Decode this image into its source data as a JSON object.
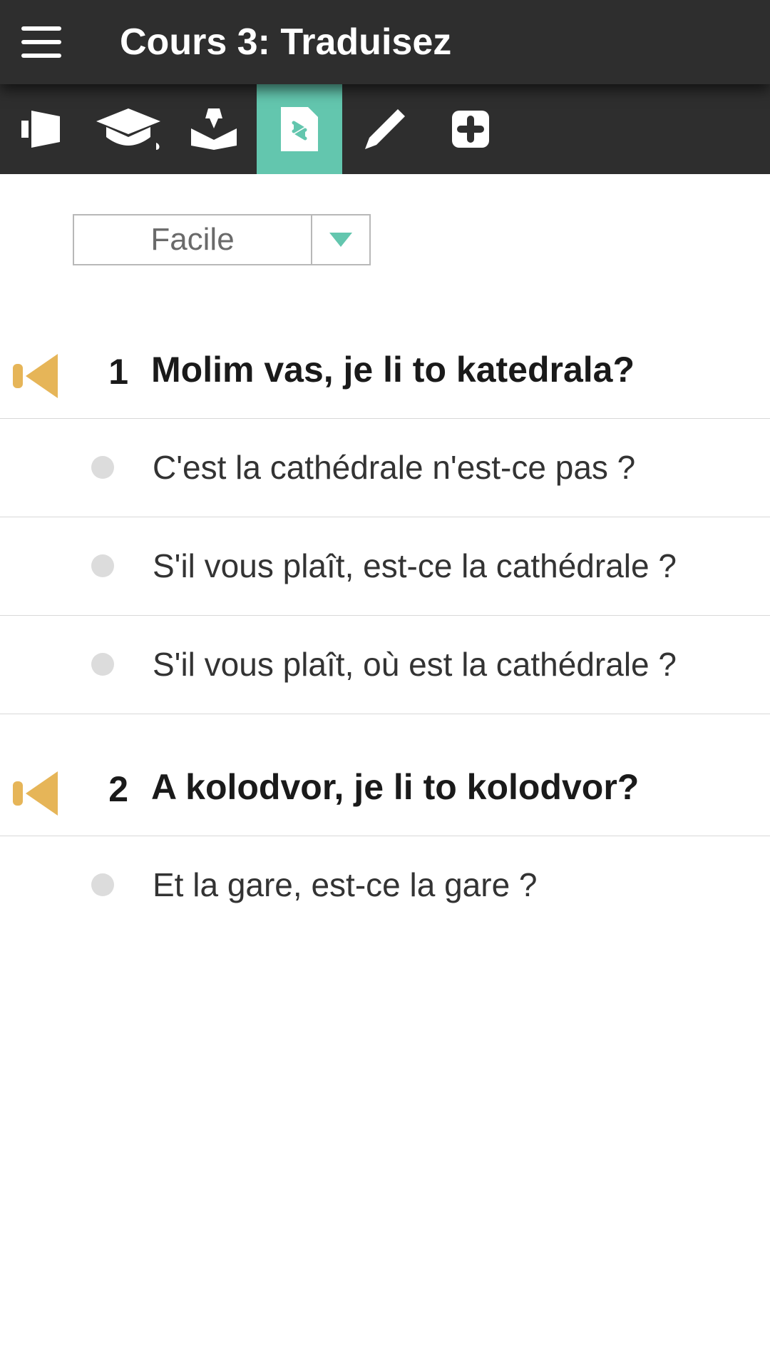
{
  "header": {
    "title": "Cours 3: Traduisez"
  },
  "toolbar": {
    "items": [
      {
        "name": "announce-icon",
        "active": false
      },
      {
        "name": "graduation-cap-icon",
        "active": false
      },
      {
        "name": "inbox-icon",
        "active": false
      },
      {
        "name": "translate-page-icon",
        "active": true
      },
      {
        "name": "pencil-icon",
        "active": false
      },
      {
        "name": "plus-icon",
        "active": false
      }
    ]
  },
  "difficulty": {
    "selected": "Facile"
  },
  "questions": [
    {
      "number": "1",
      "prompt": "Molim vas, je li to katedrala?",
      "options": [
        "C'est la cathédrale n'est-ce pas ?",
        "S'il vous plaît, est-ce la cathédrale ?",
        "S'il vous plaît, où est la cathédrale ?"
      ]
    },
    {
      "number": "2",
      "prompt": "A kolodvor, je li to kolodvor?",
      "options": [
        "Et la gare, est-ce la gare ?"
      ]
    }
  ]
}
